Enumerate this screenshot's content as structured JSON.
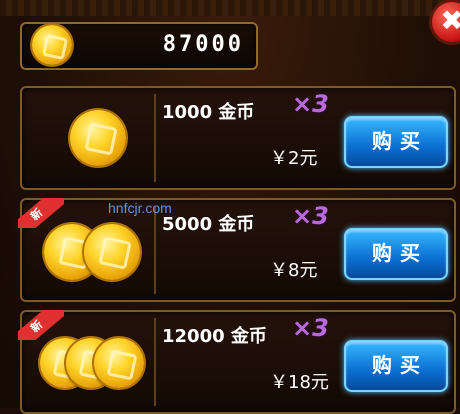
{
  "balance": {
    "value": "87000",
    "icon": "coin-icon"
  },
  "close": {
    "label": "✖"
  },
  "items": [
    {
      "name": "1000 金币",
      "multiplier": "×3",
      "price": "￥2元",
      "buy_label": "购买",
      "badge": ""
    },
    {
      "name": "5000 金币",
      "multiplier": "×3",
      "price": "￥8元",
      "buy_label": "购买",
      "badge": "新"
    },
    {
      "name": "12000 金币",
      "multiplier": "×3",
      "price": "￥18元",
      "buy_label": "购买",
      "badge": "新"
    }
  ],
  "watermark": "hnfcjr.com",
  "colors": {
    "buy_button": "#1b86e6",
    "multiplier": "#b86bd9",
    "close": "#c41212",
    "border": "#7e5a26"
  }
}
